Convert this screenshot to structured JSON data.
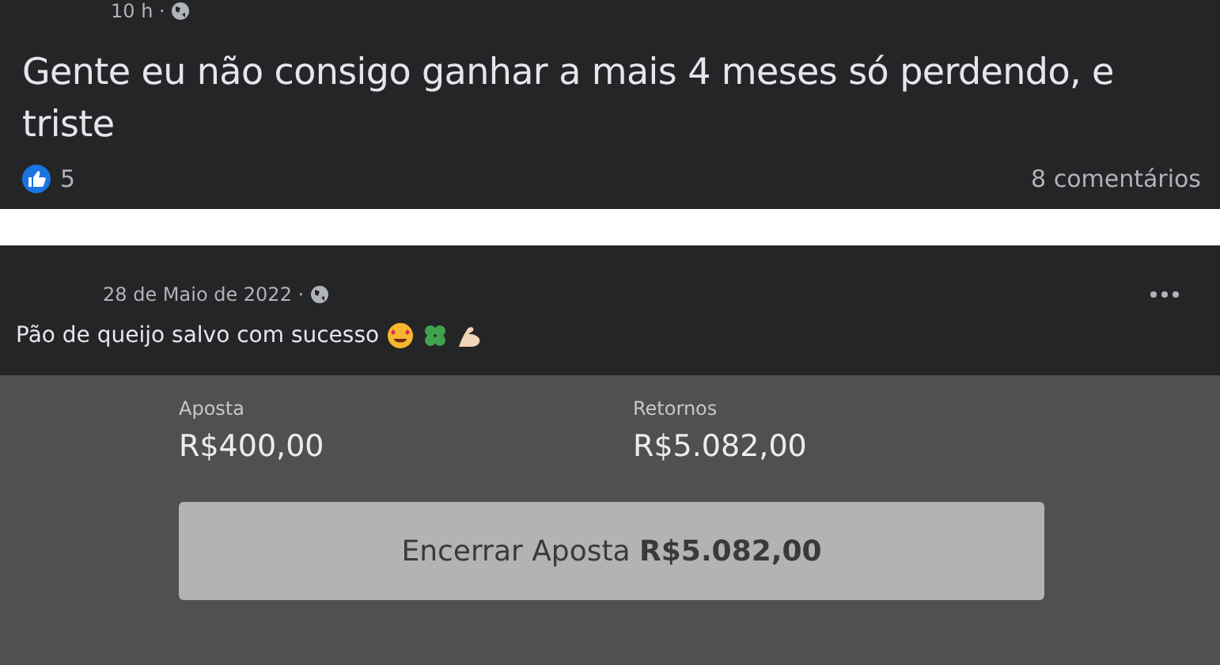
{
  "post_1": {
    "time": "10 h ·",
    "text": "Gente eu não consigo ganhar a mais 4 meses só perdendo, e triste",
    "likes": "5",
    "comments": "8 comentários"
  },
  "post_2": {
    "date": "28 de Maio de 2022 ·",
    "text": "Pão de queijo salvo com sucesso",
    "bet_slip": {
      "fields": [
        {
          "label": "Aposta",
          "value": "R$400,00"
        },
        {
          "label": "Retornos",
          "value": "R$5.082,00"
        }
      ],
      "button": "Encerrar Aposta **R$5.082,00**"
    }
  }
}
